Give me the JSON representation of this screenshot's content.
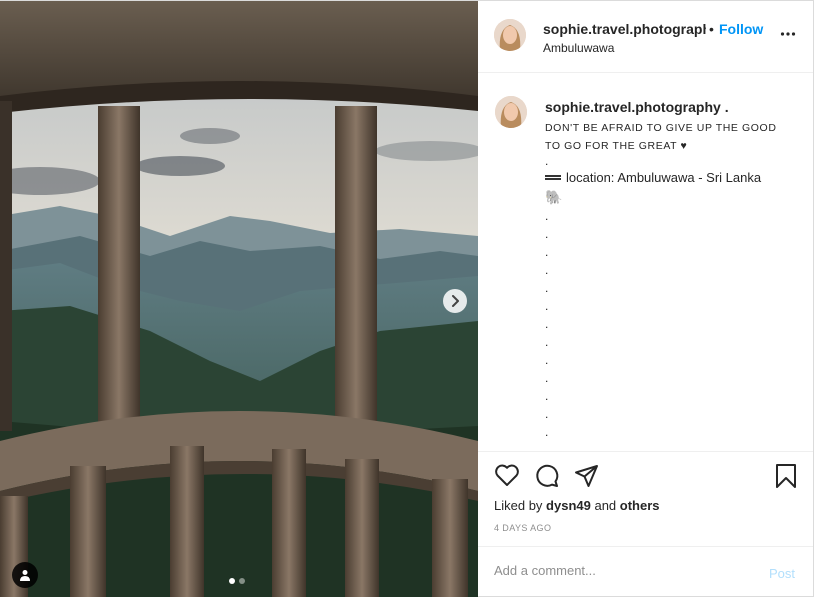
{
  "post": {
    "username": "sophie.travel.photography",
    "follow_separator": "•",
    "follow_label": "Follow",
    "location": "Ambuluwawa"
  },
  "caption": {
    "username": "sophie.travel.photography .",
    "text": "DON'T BE AFRAID TO GIVE UP THE GOOD TO GO FOR THE GREAT ♥",
    "dot": ".",
    "location_line": "location: Ambuluwawa - Sri Lanka",
    "elephant": "🐘"
  },
  "engagement": {
    "liked_prefix": "Liked by ",
    "liked_user": "dysn49",
    "liked_and": " and ",
    "liked_others": "others",
    "time_ago": "4 DAYS AGO"
  },
  "comment": {
    "placeholder": "Add a comment...",
    "post_label": "Post"
  },
  "carousel": {
    "current": 1,
    "total": 2
  },
  "icons": [
    "next-arrow-icon",
    "tag-user-icon",
    "more-options-icon",
    "heart-icon",
    "comment-icon",
    "share-icon",
    "bookmark-icon"
  ],
  "colors": {
    "follow": "#0095f6",
    "post_disabled": "#b2dffc",
    "muted": "#8e8e8e"
  }
}
